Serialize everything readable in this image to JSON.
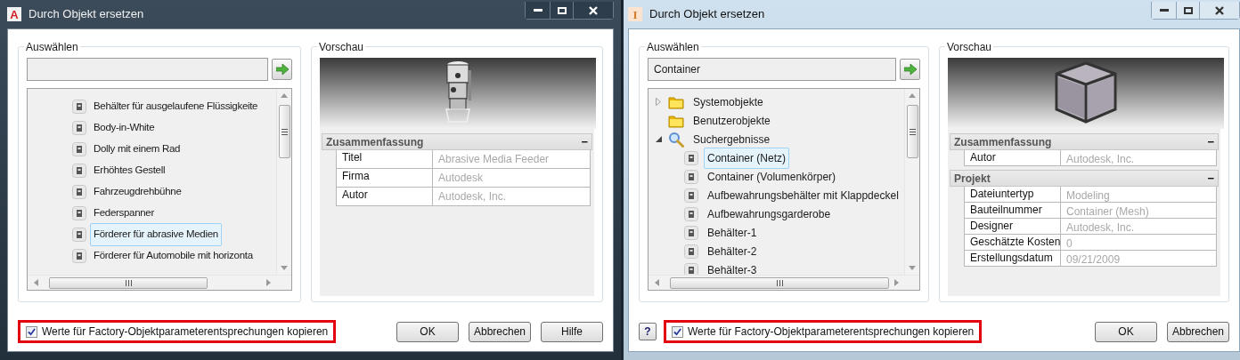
{
  "dialogs": [
    {
      "title": "Durch Objekt ersetzen",
      "app_icon_letter": "A",
      "select_group": {
        "label": "Auswählen",
        "items": [
          {
            "label": "Behälter für ausgelaufene Flüssigkeite",
            "selected": false
          },
          {
            "label": "Body-in-White",
            "selected": false
          },
          {
            "label": "Dolly mit einem Rad",
            "selected": false
          },
          {
            "label": "Erhöhtes Gestell",
            "selected": false
          },
          {
            "label": "Fahrzeugdrehbühne",
            "selected": false
          },
          {
            "label": "Federspanner",
            "selected": false
          },
          {
            "label": "Förderer für abrasive Medien",
            "selected": true
          },
          {
            "label": "Förderer für Automobile mit horizonta",
            "selected": false
          }
        ]
      },
      "preview_group": {
        "label": "Vorschau",
        "sections": [
          {
            "title": "Zusammenfassung",
            "collapse_glyph": "−",
            "rows": [
              {
                "label": "Titel",
                "value": "Abrasive Media Feeder"
              },
              {
                "label": "Firma",
                "value": "Autodesk"
              },
              {
                "label": "Autor",
                "value": "Autodesk, Inc."
              }
            ]
          }
        ]
      },
      "copy_option": {
        "label": "Werte für Factory-Objektparameterentsprechungen kopieren",
        "checked": true,
        "highlighted": true
      },
      "buttons": [
        "OK",
        "Abbrechen",
        "Hilfe"
      ]
    },
    {
      "title": "Durch Objekt ersetzen",
      "app_icon_letter": "I",
      "help_glyph": "?",
      "select_group": {
        "label": "Auswählen",
        "search_value": "Container",
        "items": [
          {
            "label": "Systemobjekte",
            "kind": "folder",
            "expanded": false,
            "selected": false
          },
          {
            "label": "Benutzerobjekte",
            "kind": "folder",
            "selected": false
          },
          {
            "label": "Suchergebnisse",
            "kind": "search",
            "expanded": true,
            "selected": false,
            "children": [
              {
                "label": "Container (Netz)",
                "selected": true
              },
              {
                "label": "Container (Volumenkörper)",
                "selected": false
              },
              {
                "label": "Aufbewahrungsbehälter mit Klappdeckel",
                "selected": false
              },
              {
                "label": "Aufbewahrungsgarderobe",
                "selected": false
              },
              {
                "label": "Behälter-1",
                "selected": false
              },
              {
                "label": "Behälter-2",
                "selected": false
              },
              {
                "label": "Behälter-3",
                "selected": false
              }
            ]
          }
        ]
      },
      "preview_group": {
        "label": "Vorschau",
        "sections": [
          {
            "title": "Zusammenfassung",
            "collapse_glyph": "−",
            "rows": [
              {
                "label": "Autor",
                "value": "Autodesk, Inc."
              }
            ]
          },
          {
            "title": "Projekt",
            "collapse_glyph": "−",
            "rows": [
              {
                "label": "Dateiuntertyp",
                "value": "Modeling"
              },
              {
                "label": "Bauteilnummer",
                "value": "Container (Mesh)"
              },
              {
                "label": "Designer",
                "value": "Autodesk, Inc."
              },
              {
                "label": "Geschätzte Kosten",
                "value": "0"
              },
              {
                "label": "Erstellungsdatum",
                "value": "09/21/2009"
              }
            ]
          }
        ]
      },
      "copy_option": {
        "label": "Werte für Factory-Objektparameterentsprechungen kopieren",
        "checked": true,
        "highlighted": true
      },
      "buttons": [
        "OK",
        "Abbrechen"
      ]
    }
  ]
}
